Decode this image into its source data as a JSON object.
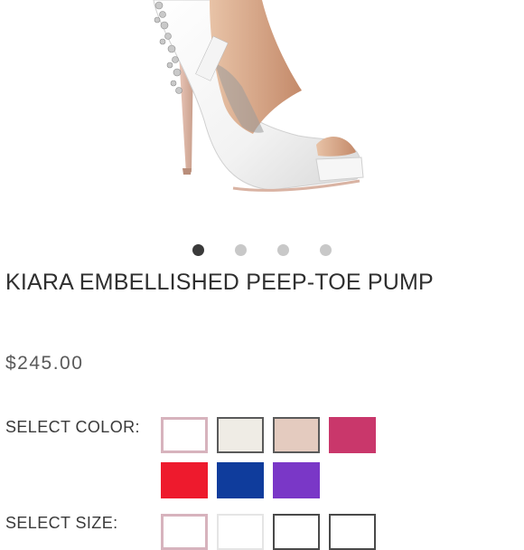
{
  "product": {
    "title": "KIARA EMBELLISHED PEEP-TOE PUMP",
    "price": "$245.00",
    "image": "white-satin-peep-toe-pump-image"
  },
  "carousel": {
    "active_index": 0,
    "dot_count": 4
  },
  "color_selector": {
    "label": "SELECT COLOR:",
    "swatches": [
      {
        "color": "#ffffff",
        "selected": true
      },
      {
        "color": "#efece5",
        "selected": false
      },
      {
        "color": "#e4cbbf",
        "selected": false
      },
      {
        "color": "#c9376b",
        "selected": false
      },
      {
        "color": "#ee1a2d",
        "selected": false
      },
      {
        "color": "#0f3c9c",
        "selected": false
      },
      {
        "color": "#7a37c7",
        "selected": false
      }
    ]
  },
  "size_selector": {
    "label": "SELECT SIZE:"
  }
}
